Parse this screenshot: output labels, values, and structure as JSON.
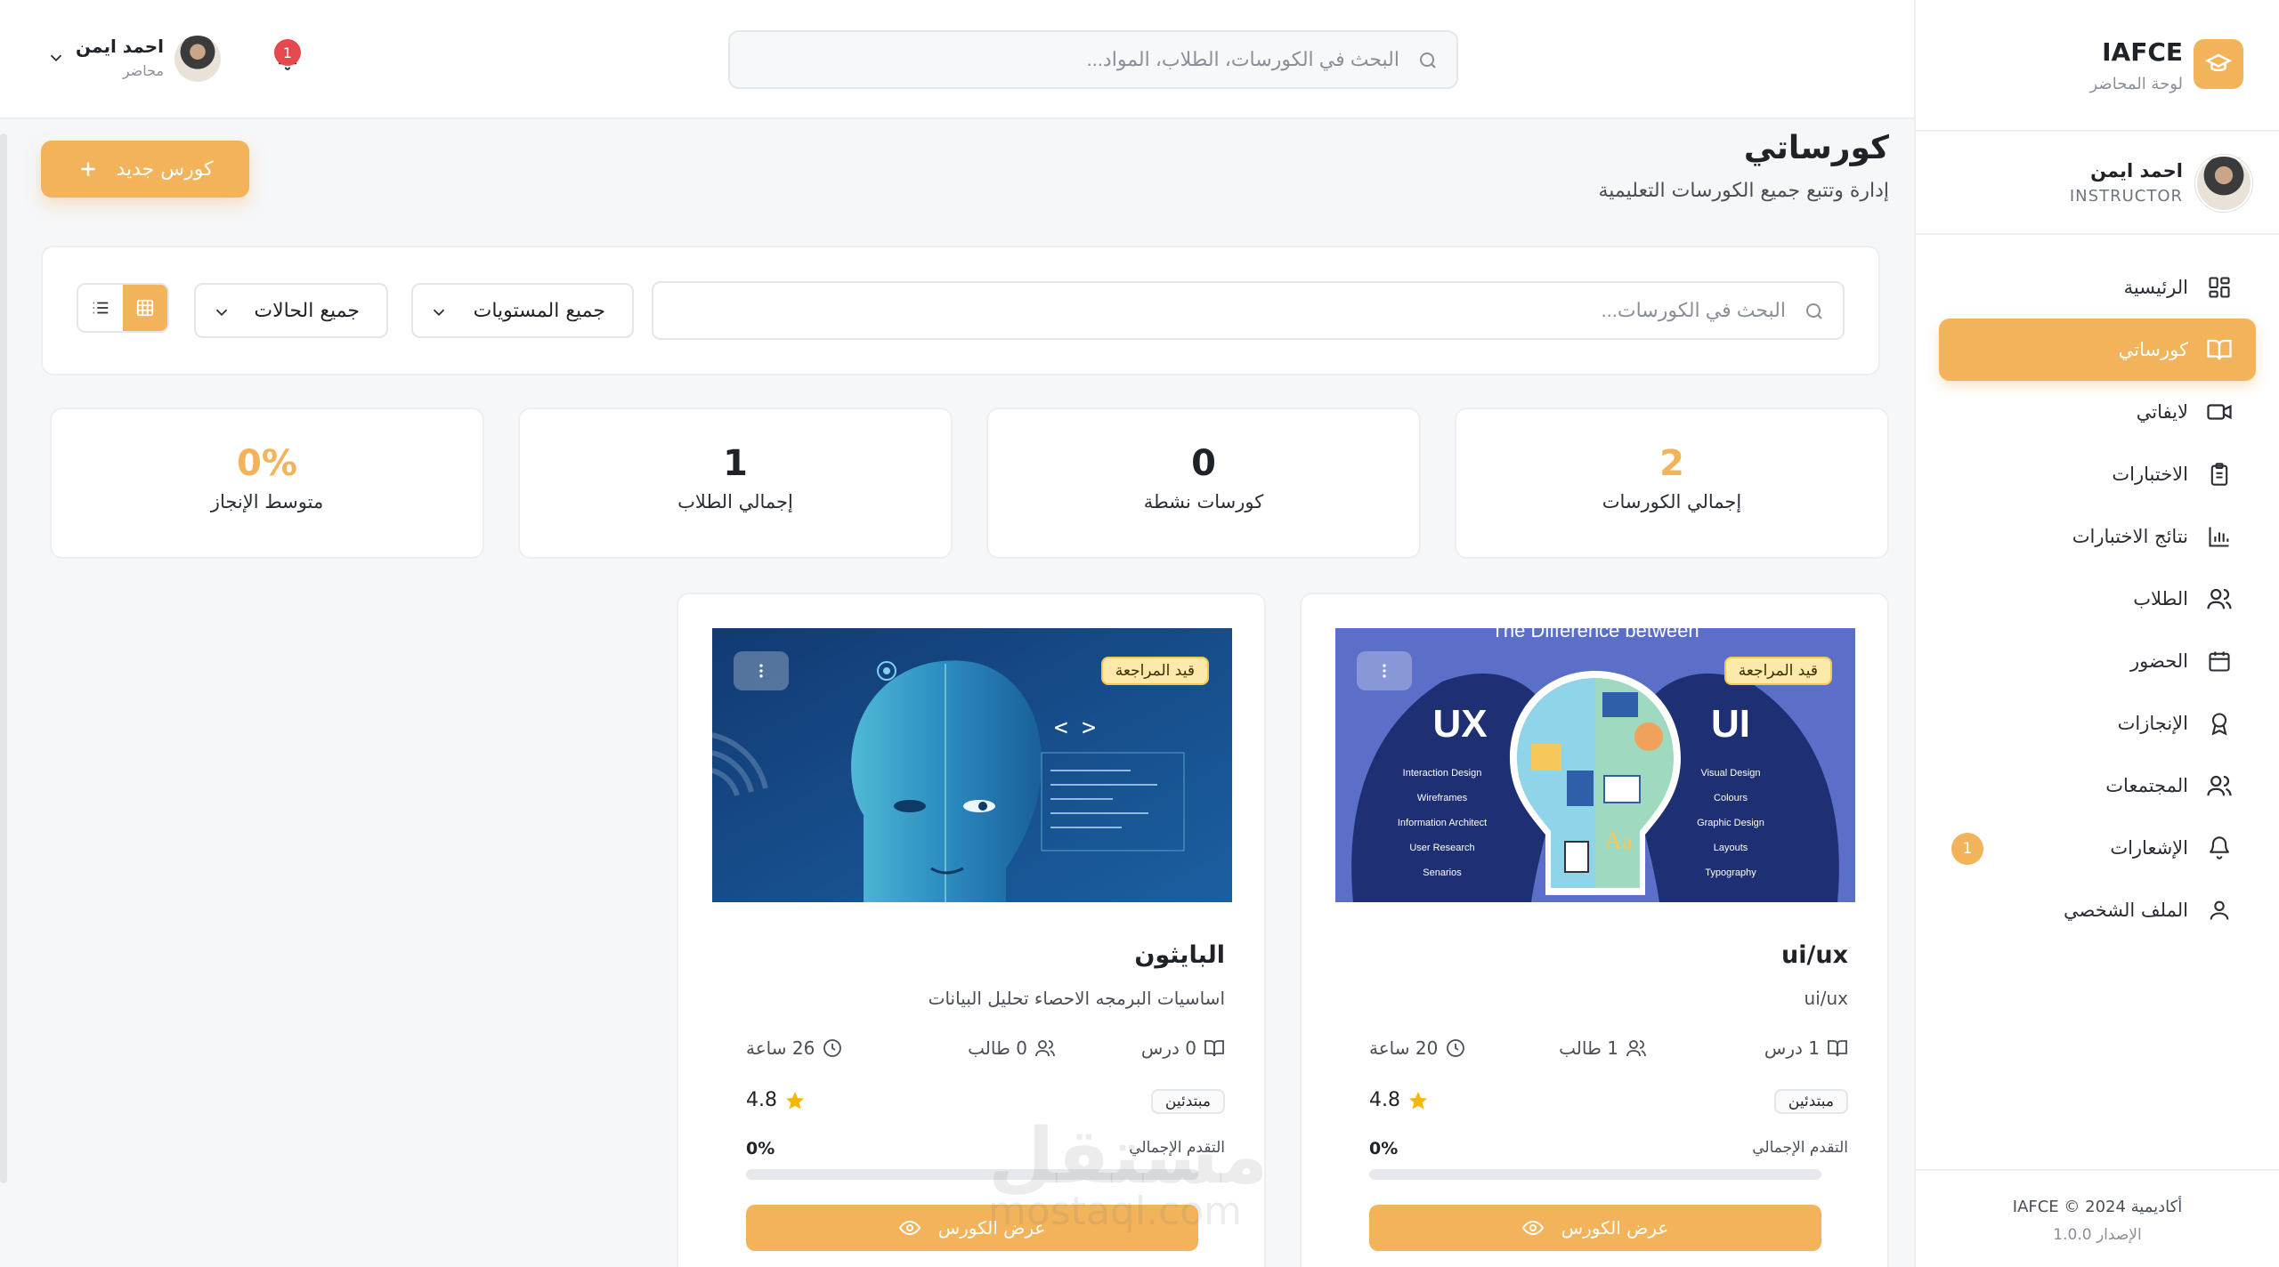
{
  "sidebar": {
    "brand_title": "IAFCE",
    "brand_sub": "لوحة المحاضر",
    "user_name": "احمد ايمن",
    "user_role": "INSTRUCTOR",
    "items": [
      {
        "label": "الرئيسية",
        "icon": "grid-icon"
      },
      {
        "label": "كورساتي",
        "icon": "book-open-icon",
        "active": true
      },
      {
        "label": "لايفاتي",
        "icon": "video-icon"
      },
      {
        "label": "الاختبارات",
        "icon": "clipboard-icon"
      },
      {
        "label": "نتائج الاختبارات",
        "icon": "bar-chart-icon"
      },
      {
        "label": "الطلاب",
        "icon": "users-icon"
      },
      {
        "label": "الحضور",
        "icon": "calendar-icon"
      },
      {
        "label": "الإنجازات",
        "icon": "award-icon"
      },
      {
        "label": "المجتمعات",
        "icon": "community-icon"
      },
      {
        "label": "الإشعارات",
        "icon": "bell-icon",
        "badge": "1"
      },
      {
        "label": "الملف الشخصي",
        "icon": "user-icon"
      }
    ],
    "footer_copy": "أكاديمية IAFCE © 2024",
    "footer_version": "الإصدار 1.0.0"
  },
  "topbar": {
    "search_placeholder": "البحث في الكورسات، الطلاب، المواد...",
    "notif_count": "1",
    "user_name": "احمد ايمن",
    "user_role": "محاضر"
  },
  "page": {
    "title": "كورساتي",
    "subtitle": "إدارة وتتبع جميع الكورسات التعليمية",
    "new_course_label": "كورس جديد"
  },
  "filters": {
    "search_placeholder": "البحث في الكورسات...",
    "level_value": "جميع المستويات",
    "status_value": "جميع الحالات"
  },
  "stats": [
    {
      "value": "2",
      "label": "إجمالي الكورسات",
      "accent": true
    },
    {
      "value": "0",
      "label": "كورسات نشطة"
    },
    {
      "value": "1",
      "label": "إجمالي الطلاب"
    },
    {
      "value": "0%",
      "label": "متوسط الإنجاز",
      "accent": true
    }
  ],
  "courses": [
    {
      "title": "ui/ux",
      "description": "ui/ux",
      "status": "قيد المراجعة",
      "lessons": "1 درس",
      "students": "1 طالب",
      "hours": "20 ساعة",
      "level": "مبتدئين",
      "rating": "4.8",
      "progress_label": "التقدم الإجمالي",
      "progress_value": "0%",
      "progress": 0,
      "button_label": "عرض الكورس",
      "thumb": {
        "heading": "The Difference between",
        "left": "UX",
        "right": "UI",
        "left_items": [
          "Interaction Design",
          "Wireframes",
          "Information Architect",
          "User Research",
          "Senarios"
        ],
        "right_items": [
          "Visual Design",
          "Colours",
          "Graphic Design",
          "Layouts",
          "Typography"
        ],
        "aa": "Aa"
      }
    },
    {
      "title": "البايثون",
      "description": "اساسيات البرمجه الاحصاء تحليل البيانات",
      "status": "قيد المراجعة",
      "lessons": "0 درس",
      "students": "0 طالب",
      "hours": "26 ساعة",
      "level": "مبتدئين",
      "rating": "4.8",
      "progress_label": "التقدم الإجمالي",
      "progress_value": "0%",
      "progress": 0,
      "button_label": "عرض الكورس",
      "thumb": {
        "code": "< >"
      }
    }
  ],
  "watermark": {
    "ar": "مستقل",
    "en": "mostaql.com"
  },
  "colors": {
    "accent": "#f2b35b",
    "danger": "#e5484d"
  }
}
